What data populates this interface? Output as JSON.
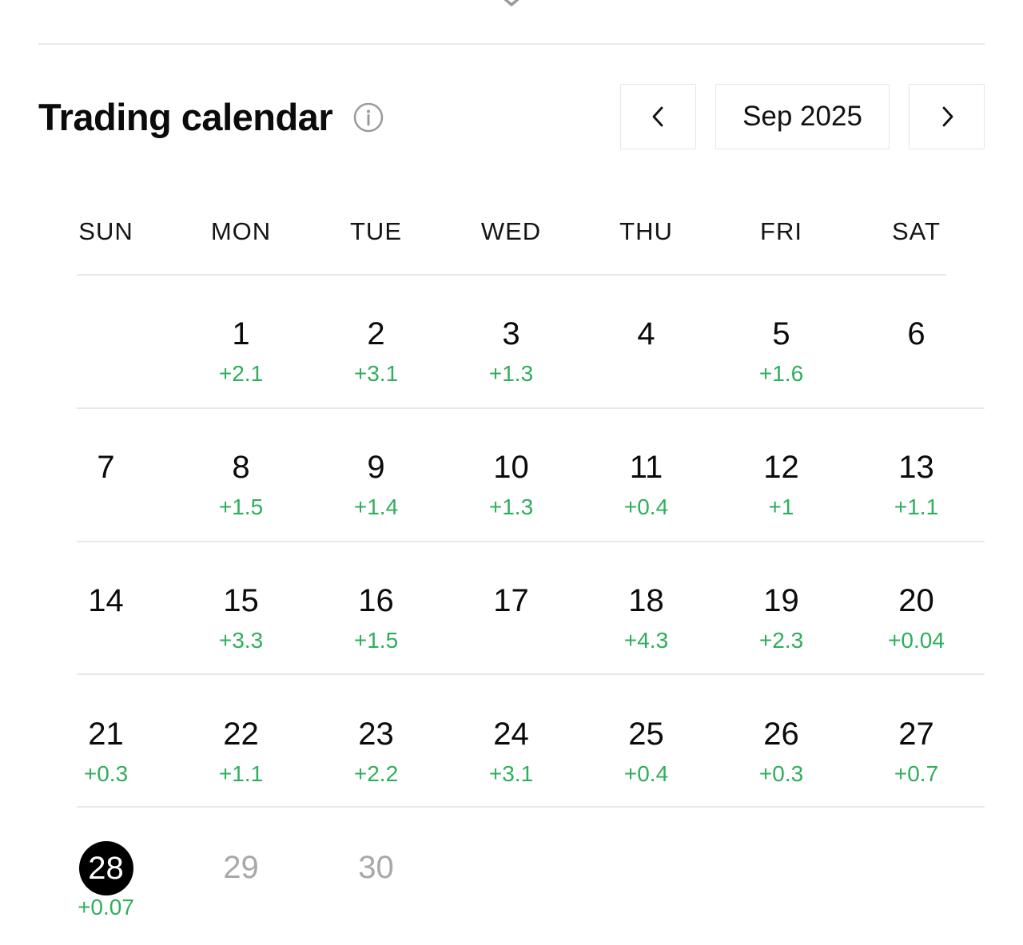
{
  "header": {
    "title": "Trading calendar",
    "month_label": "Sep 2025"
  },
  "icons": {
    "top_chevron": "chevron-down-icon",
    "info": "info-icon",
    "prev": "chevron-left-icon",
    "next": "chevron-right-icon"
  },
  "colors": {
    "positive": "#2fae5c",
    "today_bg": "#000000",
    "muted_day": "#a8a8a8",
    "divider": "#e8e8e8"
  },
  "calendar": {
    "weekdays": [
      "SUN",
      "MON",
      "TUE",
      "WED",
      "THU",
      "FRI",
      "SAT"
    ],
    "weeks": [
      [
        {
          "day": "",
          "value": ""
        },
        {
          "day": "1",
          "value": "+2.1"
        },
        {
          "day": "2",
          "value": "+3.1"
        },
        {
          "day": "3",
          "value": "+1.3"
        },
        {
          "day": "4",
          "value": ""
        },
        {
          "day": "5",
          "value": "+1.6"
        },
        {
          "day": "6",
          "value": ""
        }
      ],
      [
        {
          "day": "7",
          "value": ""
        },
        {
          "day": "8",
          "value": "+1.5"
        },
        {
          "day": "9",
          "value": "+1.4"
        },
        {
          "day": "10",
          "value": "+1.3"
        },
        {
          "day": "11",
          "value": "+0.4"
        },
        {
          "day": "12",
          "value": "+1"
        },
        {
          "day": "13",
          "value": "+1.1"
        }
      ],
      [
        {
          "day": "14",
          "value": ""
        },
        {
          "day": "15",
          "value": "+3.3"
        },
        {
          "day": "16",
          "value": "+1.5"
        },
        {
          "day": "17",
          "value": ""
        },
        {
          "day": "18",
          "value": "+4.3"
        },
        {
          "day": "19",
          "value": "+2.3"
        },
        {
          "day": "20",
          "value": "+0.04"
        }
      ],
      [
        {
          "day": "21",
          "value": "+0.3"
        },
        {
          "day": "22",
          "value": "+1.1"
        },
        {
          "day": "23",
          "value": "+2.2"
        },
        {
          "day": "24",
          "value": "+3.1"
        },
        {
          "day": "25",
          "value": "+0.4"
        },
        {
          "day": "26",
          "value": "+0.3"
        },
        {
          "day": "27",
          "value": "+0.7"
        }
      ],
      [
        {
          "day": "28",
          "value": "+0.07",
          "today": true
        },
        {
          "day": "29",
          "value": "",
          "muted": true
        },
        {
          "day": "30",
          "value": "",
          "muted": true
        },
        {
          "day": "",
          "value": ""
        },
        {
          "day": "",
          "value": ""
        },
        {
          "day": "",
          "value": ""
        },
        {
          "day": "",
          "value": ""
        }
      ]
    ]
  }
}
